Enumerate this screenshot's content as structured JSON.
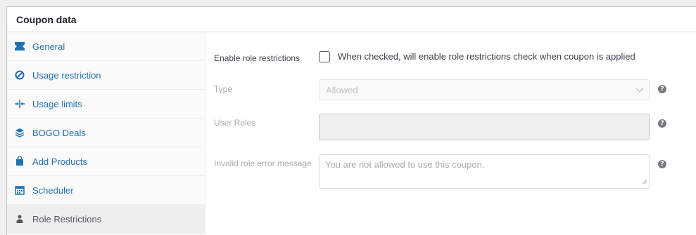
{
  "panel": {
    "title": "Coupon data"
  },
  "tabs": [
    {
      "label": "General",
      "icon": "ticket-icon"
    },
    {
      "label": "Usage restriction",
      "icon": "ban-icon"
    },
    {
      "label": "Usage limits",
      "icon": "arrows-icon"
    },
    {
      "label": "BOGO Deals",
      "icon": "stack-icon"
    },
    {
      "label": "Add Products",
      "icon": "bag-icon"
    },
    {
      "label": "Scheduler",
      "icon": "calendar-icon"
    },
    {
      "label": "Role Restrictions",
      "icon": "user-icon",
      "active": true
    }
  ],
  "fields": {
    "enable": {
      "label": "Enable role restrictions",
      "description": "When checked, will enable role restrictions check when coupon is applied",
      "checked": false
    },
    "type": {
      "label": "Type",
      "value": "Allowed",
      "help": "?"
    },
    "user_roles": {
      "label": "User Roles",
      "help": "?"
    },
    "error_message": {
      "label": "Invalid role error message",
      "placeholder": "You are not allowed to use this coupon.",
      "help": "?"
    }
  },
  "colors": {
    "link": "#2271b1",
    "active_tab_bg": "#eeeeee",
    "help_icon": "#787c82"
  }
}
